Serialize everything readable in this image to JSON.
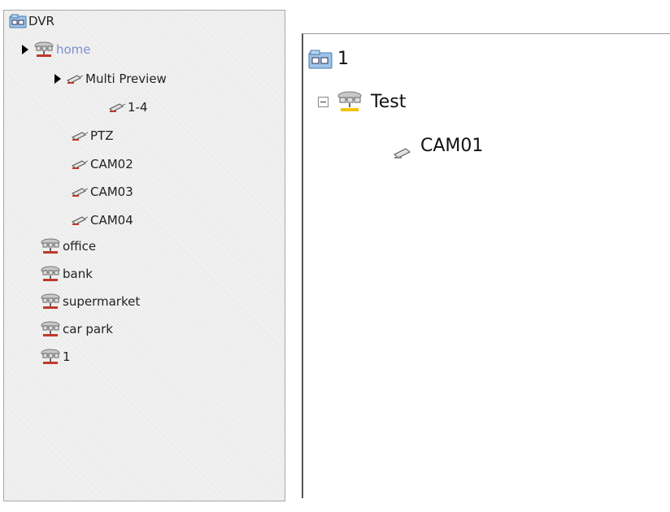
{
  "left_tree": {
    "root": {
      "label": "DVR",
      "icon": "dvr-folder-icon"
    },
    "items": [
      {
        "label": "home",
        "icon": "network-group-icon",
        "expanded_arrow": true,
        "highlighted": true
      },
      {
        "label": "Multi Preview",
        "icon": "camera-icon",
        "expanded_arrow": true
      },
      {
        "label": "1-4",
        "icon": "camera-icon"
      },
      {
        "label": "PTZ",
        "icon": "camera-icon"
      },
      {
        "label": "CAM02",
        "icon": "camera-icon"
      },
      {
        "label": "CAM03",
        "icon": "camera-icon"
      },
      {
        "label": "CAM04",
        "icon": "camera-icon"
      },
      {
        "label": "office",
        "icon": "network-group-icon"
      },
      {
        "label": "bank",
        "icon": "network-group-icon"
      },
      {
        "label": "supermarket",
        "icon": "network-group-icon"
      },
      {
        "label": "car park",
        "icon": "network-group-icon"
      },
      {
        "label": "1",
        "icon": "network-group-icon"
      }
    ]
  },
  "right_tree": {
    "root": {
      "label": "1",
      "icon": "dvr-folder-icon"
    },
    "group": {
      "label": "Test",
      "icon": "network-group-icon",
      "collapse_symbol": "−"
    },
    "camera": {
      "label": "CAM01",
      "icon": "camera-icon"
    }
  },
  "colors": {
    "highlight_text": "#7d8fd0",
    "panel_background": "#f3f3f3"
  }
}
